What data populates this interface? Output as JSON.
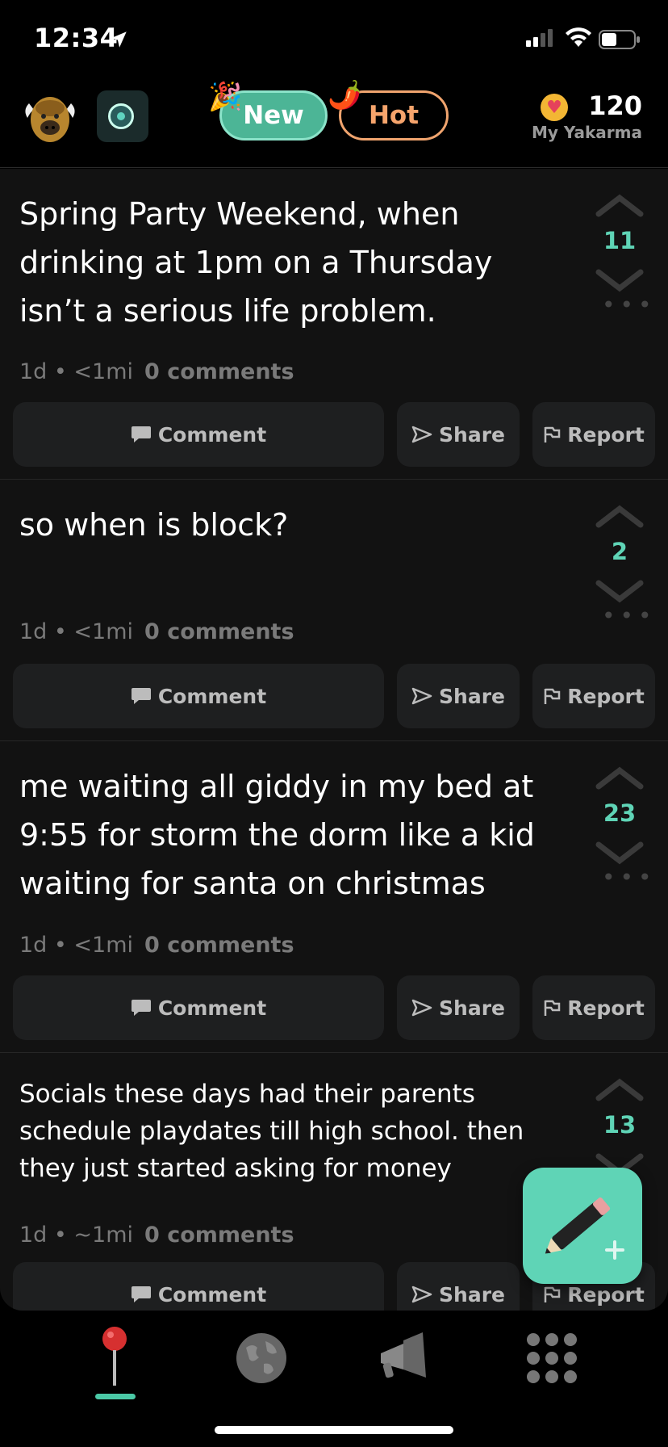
{
  "status_bar": {
    "time": "12:34"
  },
  "header": {
    "tab_new": "New",
    "tab_hot": "Hot",
    "party_emoji": "🎉",
    "pepper_emoji": "🌶️",
    "karma_value": "120",
    "karma_label": "My Yakarma"
  },
  "posts": [
    {
      "text": "Spring Party Weekend, when drinking at 1pm on a Thursday isn’t a serious life problem.",
      "meta": "1d • <1mi",
      "comments": "0 comments",
      "votes": "11"
    },
    {
      "text": "so when is block?",
      "meta": "1d • <1mi",
      "comments": "0 comments",
      "votes": "2"
    },
    {
      "text": "me waiting all giddy in my bed at 9:55 for storm the dorm like a kid waiting for santa on christmas",
      "meta": "1d • <1mi",
      "comments": "0 comments",
      "votes": "23"
    },
    {
      "text": "Socials these days had their parents schedule playdates till high school. then they just started asking for money",
      "meta": "1d • ~1mi",
      "comments": "0 comments",
      "votes": "13"
    }
  ],
  "actions": {
    "comment": "Comment",
    "share": "Share",
    "report": "Report"
  },
  "colors": {
    "accent": "#5fd4b6",
    "hot": "#f6a46c",
    "new_bg": "#4cb596"
  },
  "nav": {
    "items": [
      "pin-icon",
      "globe-icon",
      "megaphone-icon",
      "grid-icon"
    ],
    "active": "pin-icon"
  }
}
